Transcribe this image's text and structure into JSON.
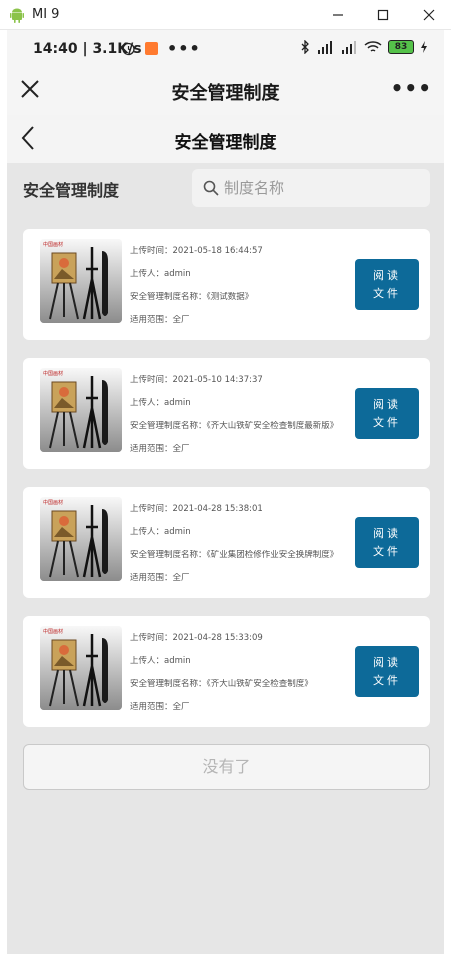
{
  "window": {
    "title": "MI 9"
  },
  "status_bar": {
    "time": "14:40",
    "speed": "| 3.1K/s",
    "battery": "83"
  },
  "navbar": {
    "title": "安全管理制度"
  },
  "page": {
    "title": "安全管理制度"
  },
  "section": {
    "title": "安全管理制度"
  },
  "search": {
    "placeholder": "制度名称"
  },
  "documents": [
    {
      "upload_time": "上传时间：2021-05-18 16:44:57",
      "uploader": "上传人：admin",
      "name": "安全管理制度名称：《测试数据》",
      "scope": "适用范围：全厂",
      "button_line1": "阅读",
      "button_line2": "文件"
    },
    {
      "upload_time": "上传时间：2021-05-10 14:37:37",
      "uploader": "上传人：admin",
      "name": "安全管理制度名称：《齐大山铁矿安全检查制度最新版》",
      "scope": "适用范围：全厂",
      "button_line1": "阅读",
      "button_line2": "文件"
    },
    {
      "upload_time": "上传时间：2021-04-28 15:38:01",
      "uploader": "上传人：admin",
      "name": "安全管理制度名称：《矿业集团检修作业安全换牌制度》",
      "scope": "适用范围：全厂",
      "button_line1": "阅读",
      "button_line2": "文件"
    },
    {
      "upload_time": "上传时间：2021-04-28 15:33:09",
      "uploader": "上传人：admin",
      "name": "安全管理制度名称：《齐大山铁矿安全检查制度》",
      "scope": "适用范围：全厂",
      "button_line1": "阅读",
      "button_line2": "文件"
    }
  ],
  "footer": {
    "no_more": "没有了"
  },
  "colors": {
    "accent": "#0d6a99",
    "background": "#e6e6e6",
    "card": "#ffffff"
  }
}
